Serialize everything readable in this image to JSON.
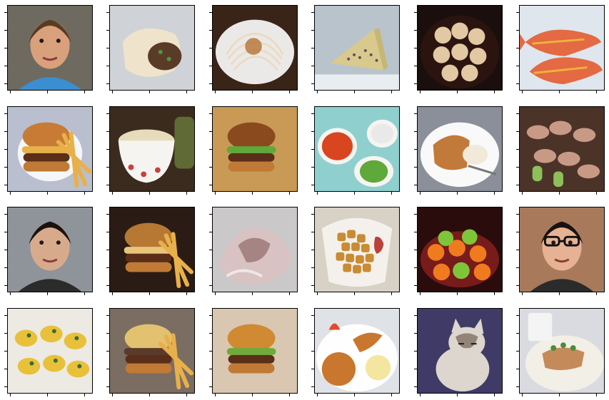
{
  "figure": {
    "rows": 4,
    "cols": 6,
    "panels": [
      {
        "subject": "portrait-boy-blue-shirt",
        "colors": {
          "bg": "#6f6a5f",
          "main": "#d9a07c",
          "accent": "#3b8ed0"
        }
      },
      {
        "subject": "burrito-wrap",
        "colors": {
          "bg": "#cfd2d6",
          "main": "#efe3cc",
          "accent": "#5a3b28"
        }
      },
      {
        "subject": "spaghetti-plate",
        "colors": {
          "bg": "#3a2418",
          "main": "#e9dcc1",
          "accent": "#b46a2a"
        }
      },
      {
        "subject": "blue-cheese-wedge",
        "colors": {
          "bg": "#b9c3cc",
          "main": "#d9c98c",
          "accent": "#3b3f63"
        }
      },
      {
        "subject": "dumplings-in-steamer",
        "colors": {
          "bg": "#1a0f0c",
          "main": "#e2c8a3",
          "accent": "#5a1d12"
        }
      },
      {
        "subject": "red-fish",
        "colors": {
          "bg": "#dfe6ee",
          "main": "#e36a42",
          "accent": "#f0b040"
        }
      },
      {
        "subject": "burger-and-fries",
        "colors": {
          "bg": "#b9bfcf",
          "main": "#c87b35",
          "accent": "#e8b04a"
        }
      },
      {
        "subject": "soup-cup",
        "colors": {
          "bg": "#3b2b1f",
          "main": "#e6dcbc",
          "accent": "#c84040"
        }
      },
      {
        "subject": "burger-in-box",
        "colors": {
          "bg": "#c89a55",
          "main": "#8a4a1e",
          "accent": "#5fa83a"
        }
      },
      {
        "subject": "salsa-and-rice-bowls",
        "colors": {
          "bg": "#8fd0cf",
          "main": "#d9451e",
          "accent": "#e9e9ea"
        }
      },
      {
        "subject": "cake-with-ice-cream",
        "colors": {
          "bg": "#8a8f9a",
          "main": "#c27a3a",
          "accent": "#f1ead9"
        }
      },
      {
        "subject": "skewered-rolls",
        "colors": {
          "bg": "#4b3328",
          "main": "#c89a86",
          "accent": "#8dbf5a"
        }
      },
      {
        "subject": "portrait-woman",
        "colors": {
          "bg": "#8e9499",
          "main": "#d8aa8c",
          "accent": "#1b1514"
        }
      },
      {
        "subject": "burger-close-up",
        "colors": {
          "bg": "#2a1c14",
          "main": "#b67832",
          "accent": "#e9c57a"
        }
      },
      {
        "subject": "translucent-dumplings",
        "colors": {
          "bg": "#cbc8c9",
          "main": "#d8c3c2",
          "accent": "#7b5050"
        }
      },
      {
        "subject": "tater-tots",
        "colors": {
          "bg": "#d8d1c6",
          "main": "#c98b33",
          "accent": "#f4f1ec"
        }
      },
      {
        "subject": "oranges-and-apples",
        "colors": {
          "bg": "#2a0c0c",
          "main": "#f07a1e",
          "accent": "#7ec53a"
        }
      },
      {
        "subject": "portrait-woman-glasses",
        "colors": {
          "bg": "#a87a5b",
          "main": "#e6b293",
          "accent": "#111111"
        }
      },
      {
        "subject": "eggs-benedict",
        "colors": {
          "bg": "#eceae3",
          "main": "#e9c03a",
          "accent": "#3a6d2f"
        }
      },
      {
        "subject": "burger-with-fries",
        "colors": {
          "bg": "#7b6d62",
          "main": "#e2c170",
          "accent": "#5a3a2a"
        }
      },
      {
        "subject": "burger-on-table",
        "colors": {
          "bg": "#d9c7b2",
          "main": "#cf8a32",
          "accent": "#6faa3a"
        }
      },
      {
        "subject": "fried-shrimp-plate",
        "colors": {
          "bg": "#dfe2e6",
          "main": "#c9772e",
          "accent": "#f4e6a0"
        }
      },
      {
        "subject": "cat",
        "colors": {
          "bg": "#3f3b66",
          "main": "#dcd6cf",
          "accent": "#7a6a5a"
        }
      },
      {
        "subject": "rice-with-chicken",
        "colors": {
          "bg": "#d9dbe0",
          "main": "#f2efe6",
          "accent": "#4b8a3a"
        }
      }
    ]
  }
}
